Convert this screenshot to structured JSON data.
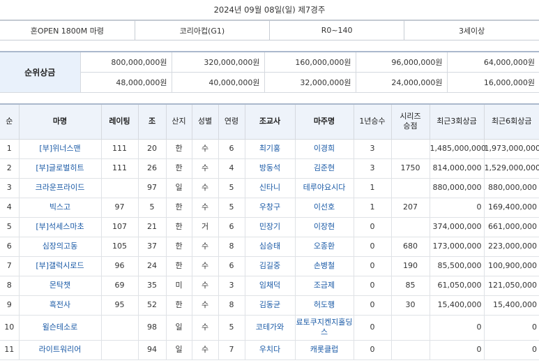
{
  "race_header": "2024년 09월 08일(일) 제7경주",
  "conditions": [
    "혼OPEN 1800M 마령",
    "코리아컵(G1)",
    "R0~140",
    "3세이상"
  ],
  "prize": {
    "label": "순위상금",
    "row1": [
      "800,000,000원",
      "320,000,000원",
      "160,000,000원",
      "96,000,000원",
      "64,000,000원"
    ],
    "row2": [
      "48,000,000원",
      "40,000,000원",
      "32,000,000원",
      "24,000,000원",
      "16,000,000원"
    ]
  },
  "columns": [
    "순",
    "마명",
    "레이팅",
    "조",
    "산지",
    "성별",
    "연령",
    "조교사",
    "마주명",
    "1년승수",
    "시리즈\n승점",
    "최근3회상금",
    "최근6회상금"
  ],
  "rows": [
    {
      "no": "1",
      "horse": "[부]위너스맨",
      "rating": "111",
      "gate": "20",
      "origin": "한",
      "sex": "수",
      "age": "6",
      "trainer": "최기홍",
      "owner": "이경희",
      "wins": "3",
      "points": "",
      "prize3": "1,485,000,000",
      "prize6": "1,973,000,000"
    },
    {
      "no": "2",
      "horse": "[부]글로벌히트",
      "rating": "111",
      "gate": "26",
      "origin": "한",
      "sex": "수",
      "age": "4",
      "trainer": "방동석",
      "owner": "김준현",
      "wins": "3",
      "points": "1750",
      "prize3": "814,000,000",
      "prize6": "1,529,000,000"
    },
    {
      "no": "3",
      "horse": "크라운프라이드",
      "rating": "",
      "gate": "97",
      "origin": "일",
      "sex": "수",
      "age": "5",
      "trainer": "신타니",
      "owner": "테루야요시다",
      "wins": "1",
      "points": "",
      "prize3": "880,000,000",
      "prize6": "880,000,000"
    },
    {
      "no": "4",
      "horse": "빅스고",
      "rating": "97",
      "gate": "5",
      "origin": "한",
      "sex": "수",
      "age": "5",
      "trainer": "우창구",
      "owner": "이선호",
      "wins": "1",
      "points": "207",
      "prize3": "0",
      "prize6": "169,400,000"
    },
    {
      "no": "5",
      "horse": "[부]석세스마초",
      "rating": "107",
      "gate": "21",
      "origin": "한",
      "sex": "거",
      "age": "6",
      "trainer": "민장기",
      "owner": "이장현",
      "wins": "0",
      "points": "",
      "prize3": "374,000,000",
      "prize6": "661,000,000"
    },
    {
      "no": "6",
      "horse": "심장의고동",
      "rating": "105",
      "gate": "37",
      "origin": "한",
      "sex": "수",
      "age": "8",
      "trainer": "심승태",
      "owner": "오종환",
      "wins": "0",
      "points": "680",
      "prize3": "173,000,000",
      "prize6": "223,000,000"
    },
    {
      "no": "7",
      "horse": "[부]갤럭시로드",
      "rating": "96",
      "gate": "24",
      "origin": "한",
      "sex": "수",
      "age": "6",
      "trainer": "김길중",
      "owner": "손병철",
      "wins": "0",
      "points": "190",
      "prize3": "85,500,000",
      "prize6": "100,900,000"
    },
    {
      "no": "8",
      "horse": "몬탁챗",
      "rating": "69",
      "gate": "35",
      "origin": "미",
      "sex": "수",
      "age": "3",
      "trainer": "임채덕",
      "owner": "조금제",
      "wins": "0",
      "points": "85",
      "prize3": "61,050,000",
      "prize6": "121,050,000"
    },
    {
      "no": "9",
      "horse": "흑전사",
      "rating": "95",
      "gate": "52",
      "origin": "한",
      "sex": "수",
      "age": "8",
      "trainer": "김동균",
      "owner": "허도행",
      "wins": "0",
      "points": "30",
      "prize3": "15,400,000",
      "prize6": "15,400,000"
    },
    {
      "no": "10",
      "horse": "윌슨테소로",
      "rating": "",
      "gate": "98",
      "origin": "일",
      "sex": "수",
      "age": "5",
      "trainer": "코테가와",
      "owner": "료토쿠지켄지홀딩스",
      "wins": "0",
      "points": "",
      "prize3": "0",
      "prize6": "0"
    },
    {
      "no": "11",
      "horse": "라이트워리어",
      "rating": "",
      "gate": "94",
      "origin": "일",
      "sex": "수",
      "age": "7",
      "trainer": "우치다",
      "owner": "캐롯클럽",
      "wins": "0",
      "points": "",
      "prize3": "0",
      "prize6": "0"
    }
  ]
}
